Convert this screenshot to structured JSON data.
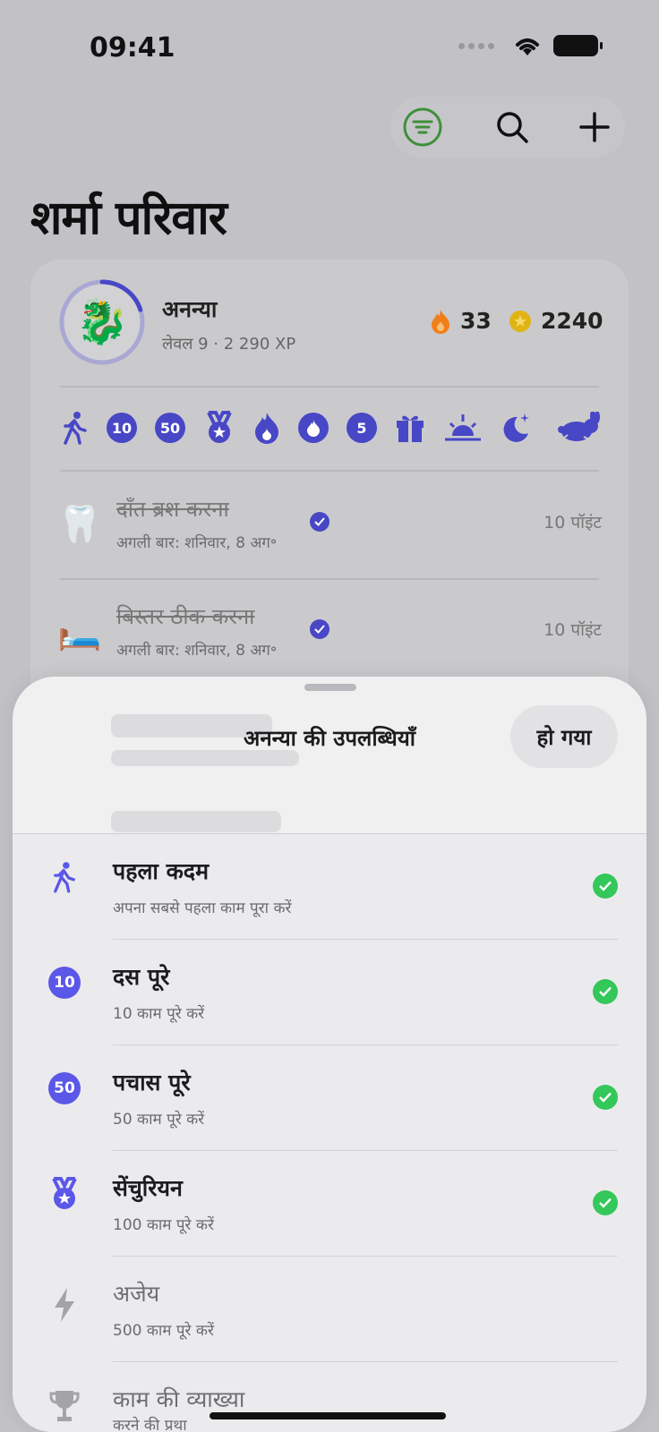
{
  "status_bar": {
    "time": "09:41"
  },
  "page_title": "शर्मा परिवार",
  "profile": {
    "name": "अनन्या",
    "level": "लेवल 9 · 2 290 XP",
    "avatar": "🐉",
    "streak": "33",
    "coins": "2240",
    "level_progress": 0.2
  },
  "badges": [
    "walking-icon",
    "10",
    "50",
    "medal-icon",
    "flame-icon",
    "flame-badge-icon",
    "5",
    "gift-icon",
    "sunrise-icon",
    "moon-icon",
    "rabbit-icon"
  ],
  "tasks": [
    {
      "emoji": "🦷",
      "title": "दाँत ब्रश करना",
      "subtitle": "अगली बार: शनिवार, 8 अग॰",
      "points": "10 पॉइंट"
    },
    {
      "emoji": "🛏️",
      "title": "बिस्तर ठीक करना",
      "subtitle": "अगली बार: शनिवार, 8 अग॰",
      "points": "10 पॉइंट"
    }
  ],
  "sheet": {
    "title": "अनन्या की उपलब्धियाँ",
    "done_label": "हो गया",
    "achievements": [
      {
        "icon": "walking-icon",
        "title": "पहला कदम",
        "desc": "अपना सबसे पहला काम पूरा करें",
        "earned": true
      },
      {
        "icon": "10",
        "title": "दस पूरे",
        "desc": "10 काम पूरे करें",
        "earned": true
      },
      {
        "icon": "50",
        "title": "पचास पूरे",
        "desc": "50 काम पूरे करें",
        "earned": true
      },
      {
        "icon": "medal-icon",
        "title": "सेंचुरियन",
        "desc": "100 काम पूरे करें",
        "earned": true
      },
      {
        "icon": "bolt-icon",
        "title": "अजेय",
        "desc": "500 काम पूरे करें",
        "earned": false
      },
      {
        "icon": "trophy-icon",
        "title": "काम की व्याख्या",
        "desc": "करने की प्रथा",
        "earned": false
      }
    ]
  },
  "colors": {
    "accent": "#4847c6",
    "success": "#34c759",
    "streak": "#f07f1a",
    "coin": "#e0b415",
    "filter": "#3f8f3a"
  }
}
